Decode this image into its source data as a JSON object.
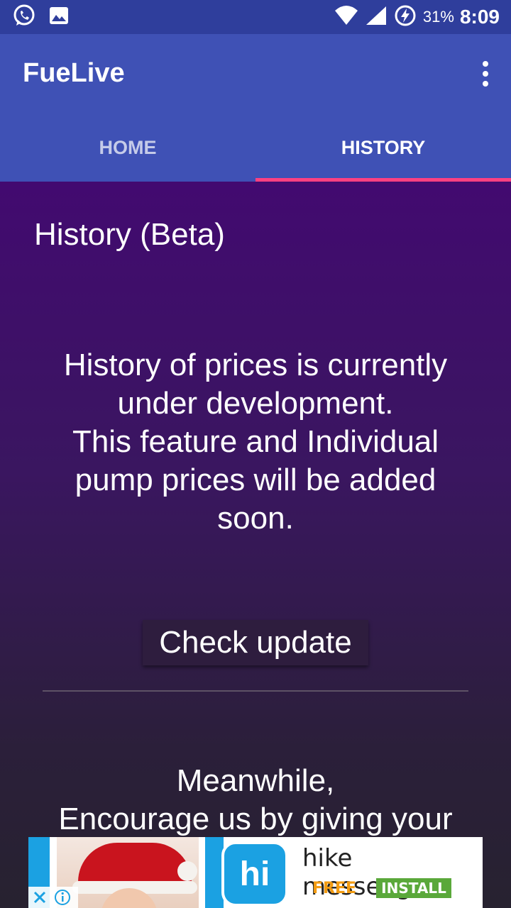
{
  "status_bar": {
    "battery_percent": "31%",
    "time": "8:09",
    "icons": [
      "whatsapp-icon",
      "image-icon",
      "wifi-icon",
      "signal-icon",
      "battery-charging-icon"
    ]
  },
  "app_bar": {
    "title": "FueLive"
  },
  "tabs": [
    {
      "label": "HOME",
      "active": false
    },
    {
      "label": "HISTORY",
      "active": true
    }
  ],
  "content": {
    "section_title": "History (Beta)",
    "message_lines": [
      "History of prices is currently",
      "under development.",
      "This feature and Individual",
      "pump prices will be added",
      "soon."
    ],
    "check_button": "Check update",
    "bottom_lines": [
      "Meanwhile,",
      "Encourage us by giving your"
    ]
  },
  "ad": {
    "app_name": "hike messenger",
    "price": "FREE",
    "install_label": "INSTALL",
    "logo_text": "hi",
    "colors": {
      "brand": "#1ba1e2",
      "free": "#f39c12",
      "install": "#5aa83a"
    }
  },
  "colors": {
    "primary": "#3f51b5",
    "primary_dark": "#2f3e9c",
    "accent": "#ff4081",
    "content_top": "#420a70",
    "content_bottom": "#272230"
  }
}
